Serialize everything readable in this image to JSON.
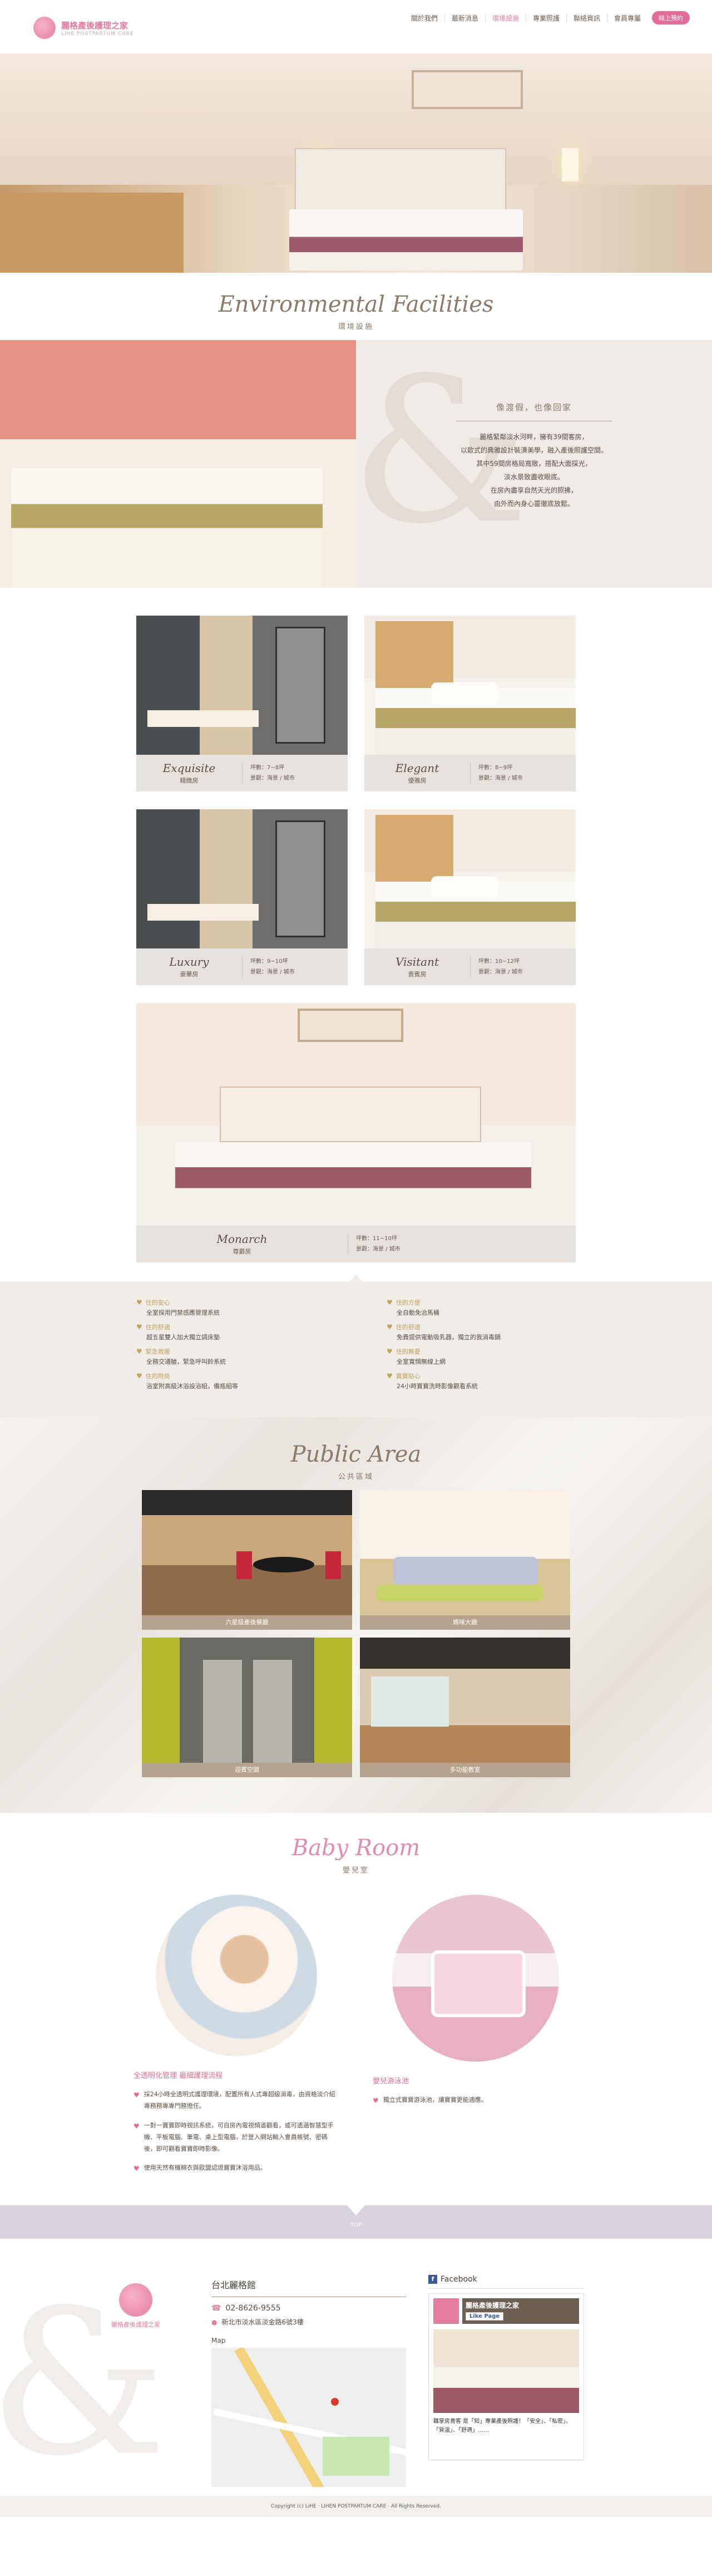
{
  "header": {
    "logo_name": "麗格產後護理之家",
    "logo_sub": "LIHE POSTPARTUM CARE",
    "nav": [
      "關於我們",
      "最新消息",
      "環境設施",
      "專業照護",
      "聯絡資訊",
      "會員專屬"
    ],
    "book_label": "線上預約"
  },
  "environment": {
    "title_en": "Environmental Facilities",
    "title_zh": "環境設施",
    "intro_heading": "像渡假，也像回家",
    "intro_lines": [
      "麗格緊鄰淡水河畔，擁有39間客房，",
      "以歐式的典雅設計裝潢美學，融入產後照護空間。",
      "其中59間房格局寬敞，搭配大面採光，",
      "淡水景致盡收眼底。",
      "在房內盡享自然天光的照拂，",
      "由外而內身心靈徹底放鬆。"
    ]
  },
  "rooms": [
    {
      "en": "Exquisite",
      "zh": "精緻房",
      "area": "坪數：7~8坪",
      "view": "景觀：海景 / 城市"
    },
    {
      "en": "Elegant",
      "zh": "優雅房",
      "area": "坪數：8~9坪",
      "view": "景觀：海景 / 城市"
    },
    {
      "en": "Luxury",
      "zh": "豪華房",
      "area": "坪數：9~10坪",
      "view": "景觀：海景 / 城市"
    },
    {
      "en": "Visitant",
      "zh": "貴賓房",
      "area": "坪數：10~12坪",
      "view": "景觀：海景 / 城市"
    },
    {
      "en": "Monarch",
      "zh": "尊爵房",
      "area": "坪數：11~10坪",
      "view": "景觀：海景 / 城市"
    }
  ],
  "features": {
    "left": [
      {
        "t": "住的安心",
        "d": "全室採用門禁感應管理系統"
      },
      {
        "t": "住的舒適",
        "d": "超五星雙人加大獨立調床墊"
      },
      {
        "t": "緊急救援",
        "d": "全務交通艙，緊急呼叫鈴系統"
      },
      {
        "t": "住的時尚",
        "d": "浴室附高級沐浴設浴組，備瓶組等"
      }
    ],
    "right": [
      {
        "t": "住的方便",
        "d": "全自動免治馬桶"
      },
      {
        "t": "住的舒適",
        "d": "免費提供電動吸乳器，獨立的我消毒鍋"
      },
      {
        "t": "住的無憂",
        "d": "全室寬頻無線上網"
      },
      {
        "t": "寶寶貼心",
        "d": "24小時寶寶洗時影像觀看系統"
      }
    ]
  },
  "public_area": {
    "title_en": "Public Area",
    "title_zh": "公共區域",
    "labels": [
      "六星級產後餐廳",
      "媽咪大廳",
      "迎賓空間",
      "多功能教室"
    ]
  },
  "baby_room": {
    "title_en": "Baby Room",
    "title_zh": "嬰兒室",
    "left_heading": "全透明化管理 最細護理流程",
    "left_items": [
      "採24小時全透明式護理環境，配置所有人式專超級消毒，由資格淡介紹專務務專專門務擔任。",
      "一對一寶寶即時視訊系統，可自房內電視頻道觀看，或可透過智慧型手機、平板電腦、筆電、桌上型電腦，於登入網站輸入會員帳號、密碼後，即可觀看寶寶即時影像。",
      "使用天然有機棉衣與歐盟認證寶寶沐浴用品。"
    ],
    "right_heading": "嬰兒游泳池",
    "right_items": [
      "獨立式寶寶游泳池，讓寶寶更能適應。"
    ]
  },
  "top_label": "TOP",
  "footer": {
    "logo_name": "麗格產後護理之家",
    "branch": "台北麗格館",
    "phone": "02-8626-9555",
    "address": "新北市淡水區淡金路6號3樓",
    "map_label": "Map",
    "fb_heading": "Facebook",
    "fb_page": "麗格產後護理之家",
    "fb_like": "Like Page",
    "fb_post": "職掌房貴客 是「知」專業產後照護！「安全」、「私密」、「質溫」、「舒適」……",
    "copyright": "Copyright (c) LiHE · LIHEN POSTPARTUM CARE · All Rights Reserved."
  }
}
